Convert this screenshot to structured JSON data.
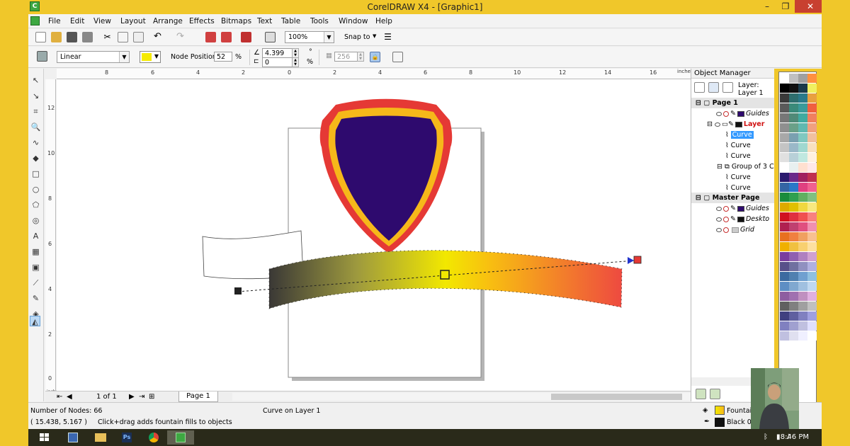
{
  "window": {
    "title": "CorelDRAW X4 - [Graphic1]",
    "minimize": "–",
    "restore": "❐",
    "close": "✕"
  },
  "menu": [
    "File",
    "Edit",
    "View",
    "Layout",
    "Arrange",
    "Effects",
    "Bitmaps",
    "Text",
    "Table",
    "Tools",
    "Window",
    "Help"
  ],
  "standard_toolbar": {
    "zoom_level": "100%",
    "snap_to": "Snap to"
  },
  "property_bar": {
    "fill_type": "Linear",
    "node_position_label": "Node Position:",
    "node_position_value": "52",
    "percent": "%",
    "angle_value": "4.399",
    "angle_unit": "°",
    "edge_pad_value": "0",
    "edge_pad_unit": "%",
    "steps_value": "256",
    "node_color": "#f5ea00"
  },
  "ruler": {
    "top_labels": [
      "8",
      "6",
      "4",
      "2",
      "0",
      "2",
      "4",
      "6",
      "8",
      "10",
      "12",
      "14",
      "16"
    ],
    "unit": "inches",
    "left_labels": [
      "12",
      "10",
      "8",
      "6",
      "4",
      "2",
      "0"
    ],
    "left_unit": "inches"
  },
  "page_nav": {
    "count": "1 of 1",
    "tab": "Page 1"
  },
  "object_manager": {
    "title": "Object Manager",
    "layer_label": "Layer:",
    "layer_name": "Layer 1",
    "page1": "Page 1",
    "guides": "Guides",
    "layer": "Layer",
    "curve_selected": "Curve",
    "curve": "Curve",
    "group": "Group of 3 C",
    "master_page": "Master Page",
    "desktop": "Deskto",
    "grid": "Grid"
  },
  "status": {
    "nodes": "Number of Nodes: 66",
    "object": "Curve on Layer 1",
    "coords": "( 15.438, 5.167 )",
    "hint": "Click+drag adds fountain fills to objects",
    "fill_label": "Fountain",
    "outline_label": "Black  0."
  },
  "taskbar": {
    "clock": "8:46 PM"
  },
  "colors": {
    "shield_purple": "#2e0a6e",
    "shield_red": "#e53935",
    "shield_gold": "#f6b81a",
    "accent_yellow": "#f0c72a"
  }
}
